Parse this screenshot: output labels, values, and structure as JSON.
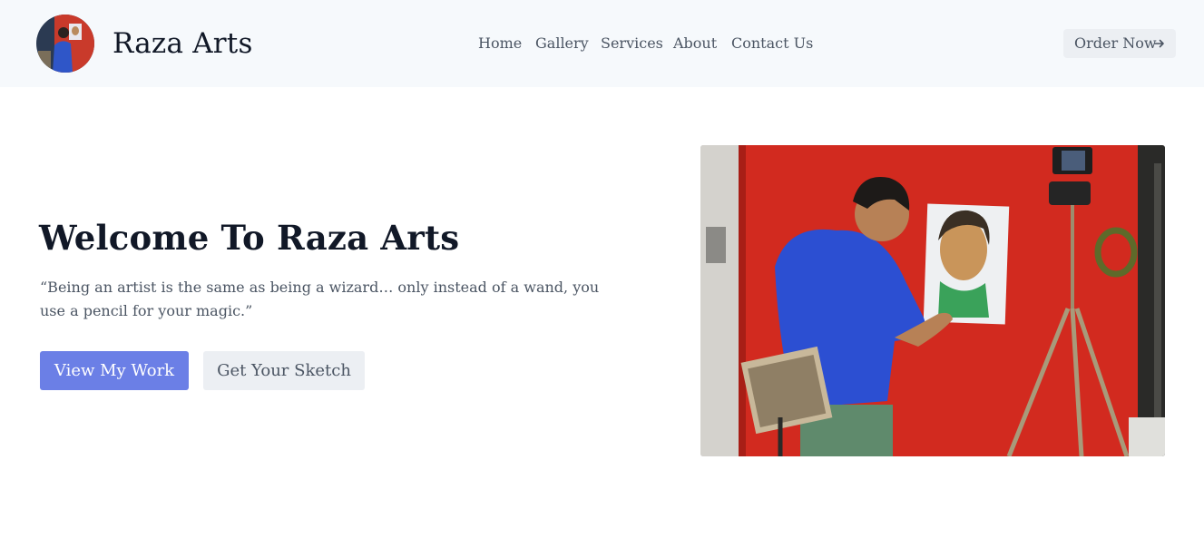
{
  "header": {
    "brand": "Raza Arts",
    "logo_icon": "artist-avatar-icon",
    "nav": [
      {
        "label": "Home"
      },
      {
        "label": "Gallery"
      },
      {
        "label": "Services"
      },
      {
        "label": "About"
      },
      {
        "label": "Contact Us"
      }
    ],
    "order_label": "Order Now",
    "order_icon": "arrow-right-icon"
  },
  "hero": {
    "title": "Welcome To Raza Arts",
    "quote": "“Being an artist is the same as being a wizard… only instead of a wand, you use a pencil for your magic.”",
    "primary_button": "View My Work",
    "secondary_button": "Get Your Sketch",
    "image_icon": "artist-painting-photo"
  },
  "colors": {
    "header_bg": "#f6f9fc",
    "primary": "#6b7fe6",
    "secondary_bg": "#eceff3",
    "text_dark": "#111827",
    "text_muted": "#4b5563"
  }
}
